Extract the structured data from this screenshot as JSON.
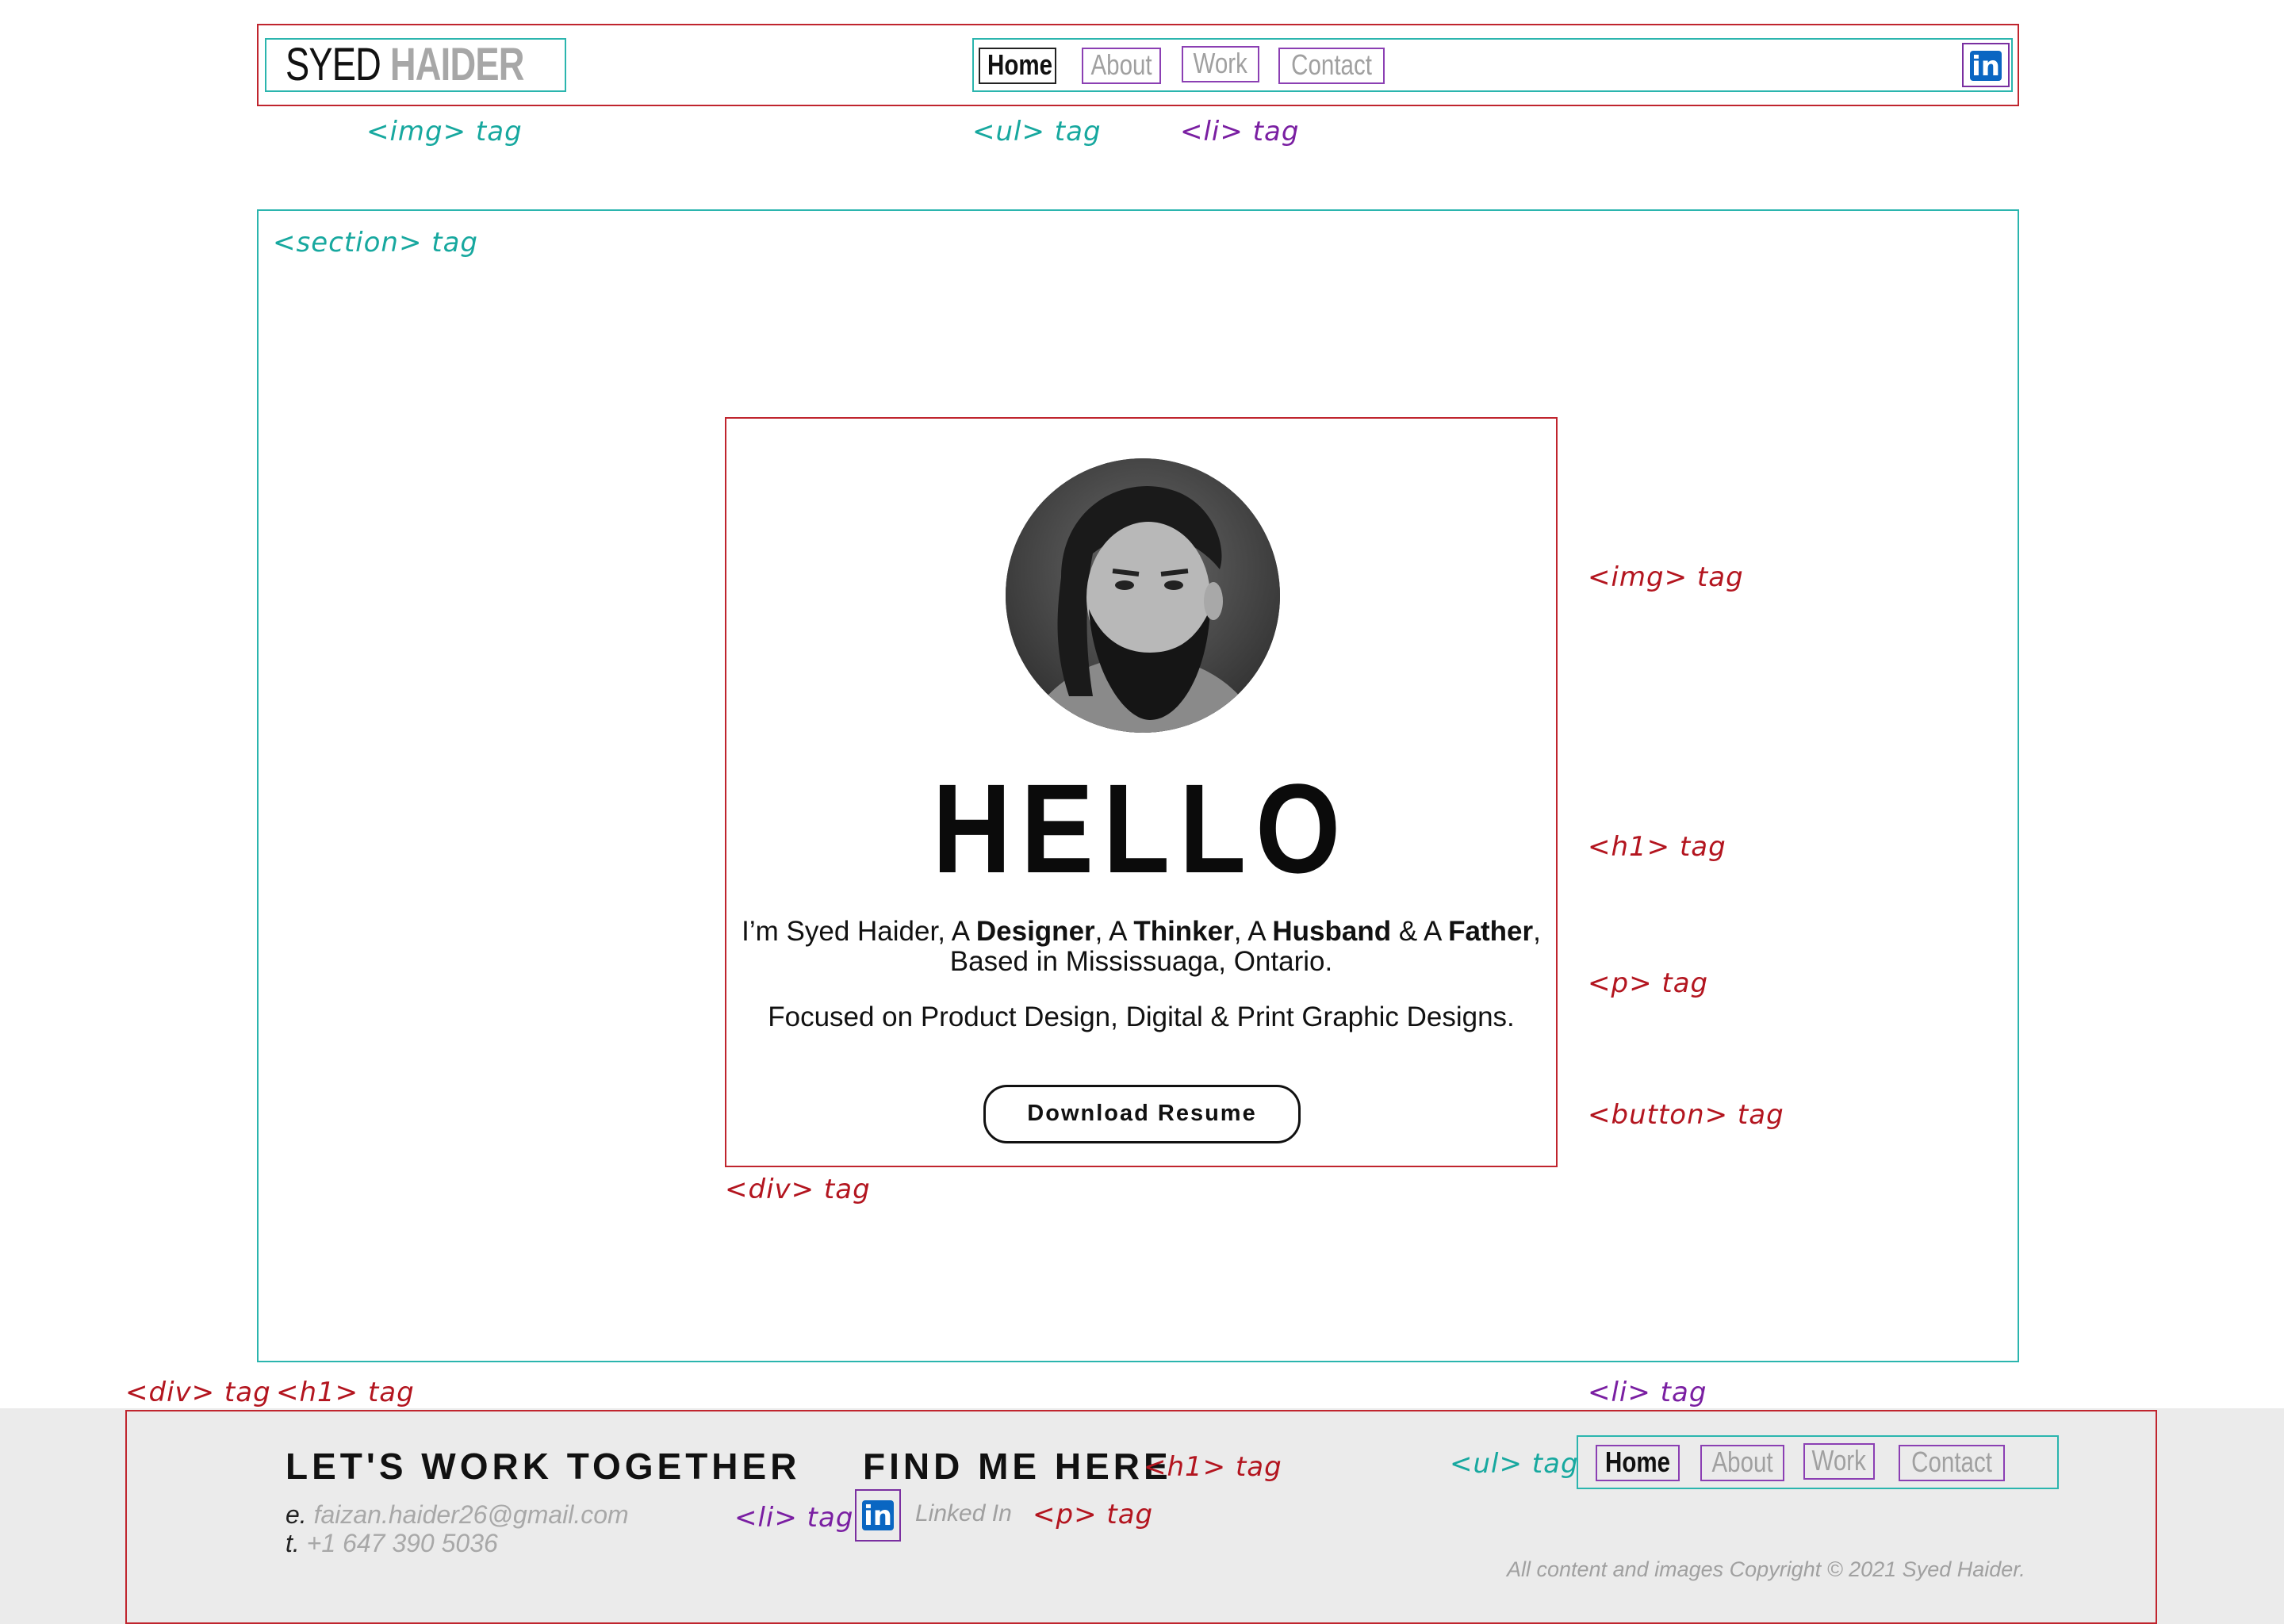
{
  "header": {
    "logo_light": "SYED",
    "logo_bold": "HAIDER",
    "nav": [
      "Home",
      "About",
      "Work",
      "Contact"
    ],
    "linkedin_glyph": "in"
  },
  "annotations": {
    "img_top": "<img> tag",
    "ul_top": "<ul> tag",
    "li_top": "<li> tag",
    "section": "<section> tag",
    "img_right": "<img> tag",
    "h1_right": "<h1> tag",
    "p_right": "<p> tag",
    "button_right": "<button> tag",
    "div_card": "<div> tag",
    "div_footer": "<div> tag",
    "h1_footer": "<h1> tag",
    "li_footer_right": "<li> tag",
    "h1_find": "<h1> tag",
    "ul_footer": "<ul> tag",
    "li_footer_icon": "<li> tag",
    "p_footer": "<p> tag"
  },
  "hero": {
    "title": "HELLO",
    "intro_1": "I’m Syed Haider, A ",
    "designer": "Designer",
    "sep1": ", A ",
    "thinker": "Thinker",
    "sep2": ", A ",
    "husband": "Husband",
    "sep3": " & A ",
    "father": "Father",
    "sep4": ",",
    "intro_2": "Based in Mississuaga, Ontario.",
    "focus": "Focused on Product Design, Digital & Print Graphic Designs.",
    "button": "Download Resume"
  },
  "footer": {
    "heading_work": "LET'S WORK TOGETHER",
    "email_key": "e.",
    "email": "faizan.haider26@gmail.com",
    "phone_key": "t.",
    "phone": "+1 647 390 5036",
    "heading_find": "FIND ME HERE",
    "linkedin_glyph": "in",
    "linkedin_label": "Linked In",
    "nav": [
      "Home",
      "About",
      "Work",
      "Contact"
    ],
    "copyright": "All content and images Copyright © 2021 Syed Haider."
  },
  "colors": {
    "teal": "#2bb5ae",
    "red": "#c0252e",
    "purple": "#7a2fa0",
    "linkedin": "#0a66c2",
    "footer_bg": "#ebebeb"
  },
  "icons": [
    "linkedin-icon",
    "profile-photo"
  ]
}
